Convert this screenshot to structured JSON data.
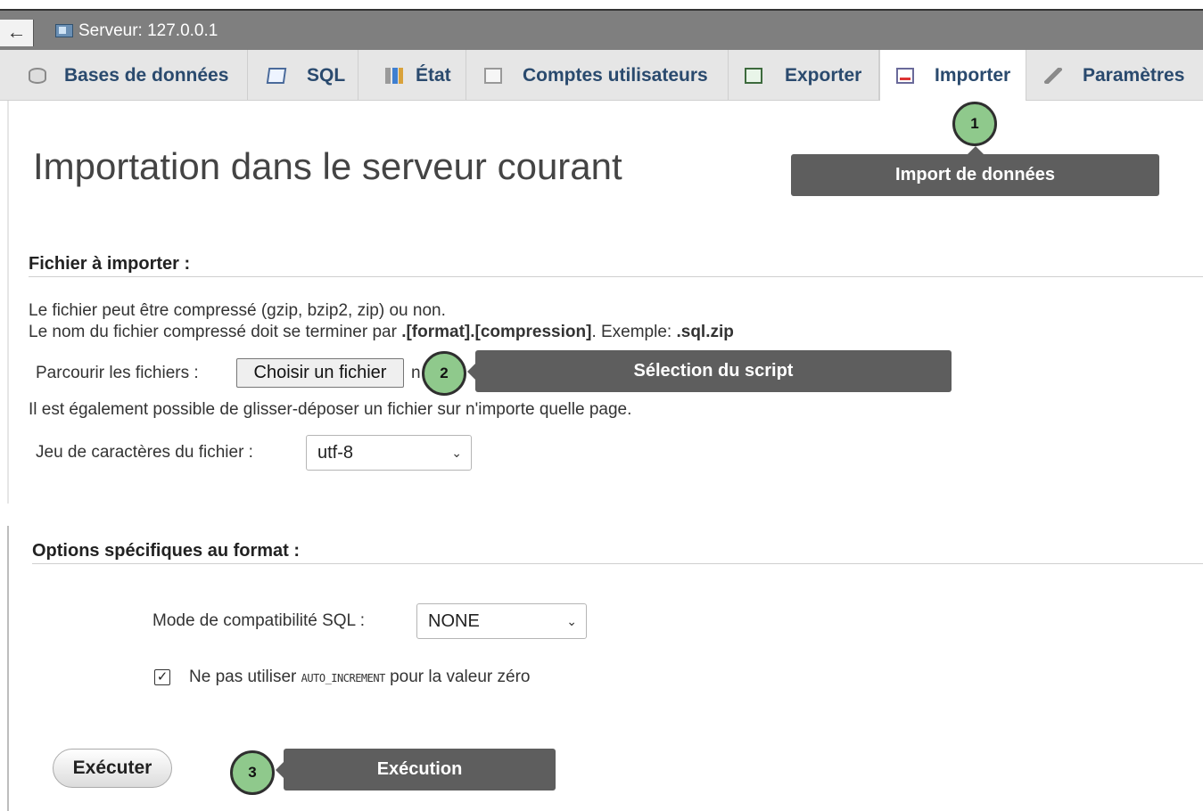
{
  "topbar": {
    "back_symbol": "←",
    "server_label": "Serveur: 127.0.0.1"
  },
  "tabs": [
    {
      "label": "Bases de données",
      "icon": "database-icon",
      "active": false
    },
    {
      "label": "SQL",
      "icon": "sql-icon",
      "active": false
    },
    {
      "label": "État",
      "icon": "status-icon",
      "active": false
    },
    {
      "label": "Comptes utilisateurs",
      "icon": "users-icon",
      "active": false
    },
    {
      "label": "Exporter",
      "icon": "export-icon",
      "active": false
    },
    {
      "label": "Importer",
      "icon": "import-icon",
      "active": true
    },
    {
      "label": "Paramètres",
      "icon": "settings-icon",
      "active": false
    }
  ],
  "page_title": "Importation dans le serveur courant",
  "file_section": {
    "title": "Fichier à importer :",
    "line1": "Le fichier peut être compressé (gzip, bzip2, zip) ou non.",
    "line2_prefix": "Le nom du fichier compressé doit se terminer par ",
    "line2_format": ".[format].[compression]",
    "line2_middle": ". Exemple: ",
    "line2_example": ".sql.zip",
    "browse_label": "Parcourir les fichiers :",
    "choose_button": "Choisir un fichier",
    "no_file_fragment": "n",
    "drag_text": "Il est également possible de glisser-déposer un fichier sur n'importe quelle page.",
    "charset_label": "Jeu de caractères du fichier :",
    "charset_value": "utf-8"
  },
  "format_section": {
    "title": "Options spécifiques au format :",
    "compat_label": "Mode de compatibilité SQL :",
    "compat_value": "NONE",
    "checkbox_checked": true,
    "checkbox_prefix": "Ne pas utiliser ",
    "checkbox_code": "AUTO_INCREMENT",
    "checkbox_suffix": " pour la valeur zéro"
  },
  "execute_button": "Exécuter",
  "annotations": [
    {
      "number": "1",
      "text": "Import de données"
    },
    {
      "number": "2",
      "text": "Sélection du script"
    },
    {
      "number": "3",
      "text": "Exécution"
    }
  ],
  "colors": {
    "badge": "#8fc98c",
    "callout": "#5e5e5e",
    "tab_text": "#2a4a6e",
    "topbar": "#7f7f7f"
  }
}
